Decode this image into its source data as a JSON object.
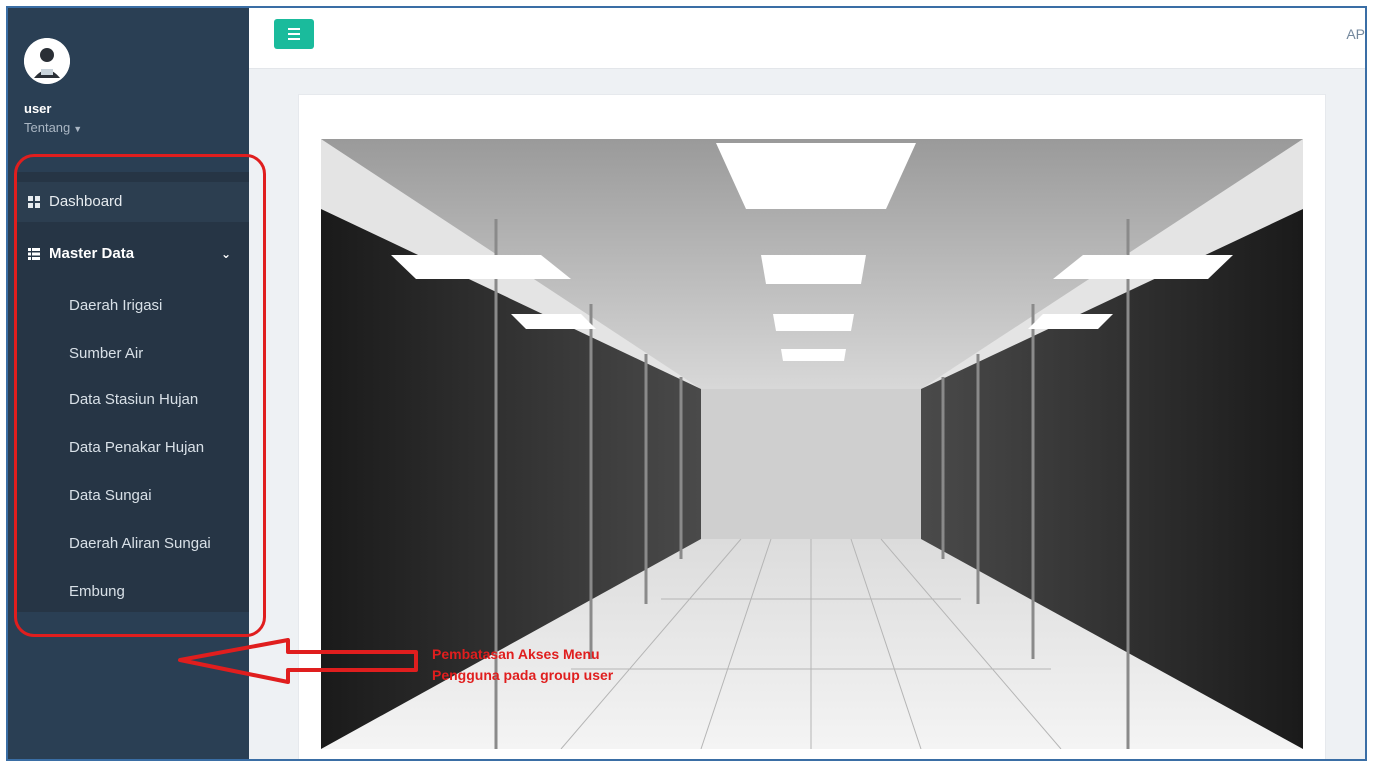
{
  "sidebar": {
    "user": "user",
    "about_label": "Tentang",
    "menu": {
      "dashboard": "Dashboard",
      "master_data": "Master Data",
      "submenu": [
        "Daerah Irigasi",
        "Sumber Air",
        "Data Stasiun Hujan",
        "Data Penakar Hujan",
        "Data Sungai",
        "Daerah Aliran Sungai",
        "Embung"
      ]
    }
  },
  "topbar": {
    "right_text": "AP"
  },
  "annotation": {
    "text": "Pembatasan Akses Menu Pengguna pada group user"
  },
  "colors": {
    "sidebar_bg": "#2a3f54",
    "menu_bg": "#263545",
    "toggle_button": "#1abb9c",
    "annotation_red": "#e01e1e",
    "frame_border": "#3a6ea5"
  },
  "icons": {
    "avatar": "user-avatar-icon",
    "dashboard": "grid-icon",
    "master_data": "list-icon",
    "toggle": "hamburger-menu-icon",
    "about_caret": "caret-down-icon",
    "master_chevron": "chevron-down-icon"
  }
}
